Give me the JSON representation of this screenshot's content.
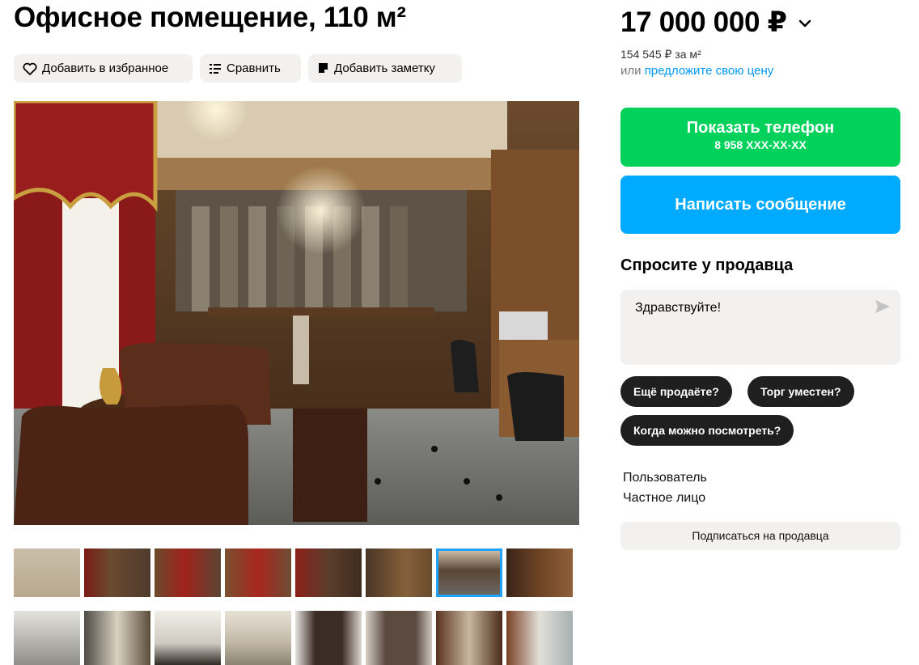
{
  "listing": {
    "title": "Офисное помещение, 110 м²",
    "actions": {
      "favorite_label": "Добавить в избранное",
      "compare_label": "Сравнить",
      "note_label": "Добавить заметку"
    },
    "gallery": {
      "active_thumbnail_index": 6,
      "row1_count": 8,
      "row2_count": 8
    }
  },
  "sidebar": {
    "price": "17 000 000 ₽",
    "price_per_m2": "154 545 ₽ за м²",
    "offer_prefix": "или",
    "offer_link": "предложите свою цену",
    "phone_button": {
      "label": "Показать телефон",
      "number": "8 958 XXX-XX-XX"
    },
    "message_button_label": "Написать сообщение",
    "ask_title": "Спросите у продавца",
    "message_text": "Здравствуйте!",
    "quick_questions": [
      "Ещё продаёте?",
      "Торг уместен?",
      "Когда можно посмотреть?"
    ],
    "seller_role": "Пользователь",
    "seller_type": "Частное лицо",
    "subscribe_label": "Подписаться на продавца"
  },
  "colors": {
    "phone_button": "#02d15c",
    "message_button": "#00aaff",
    "link": "#0099f7",
    "chip": "#1f1f1f",
    "active_thumb_border": "#1fa3ff"
  },
  "icons": [
    "heart-icon",
    "compare-icon",
    "note-icon",
    "chevron-down-icon",
    "send-icon"
  ]
}
